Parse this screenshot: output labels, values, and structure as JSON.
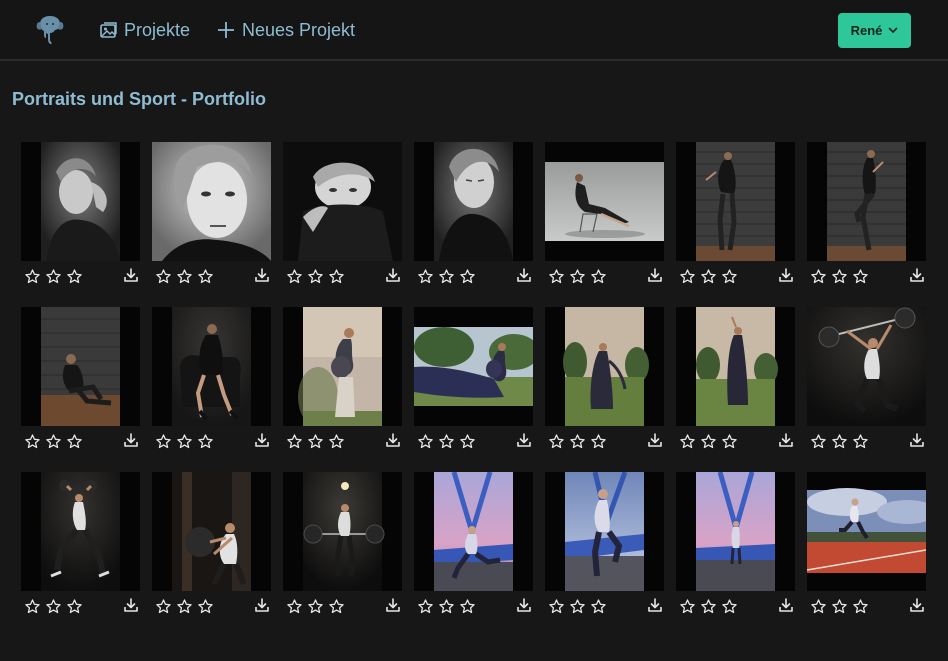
{
  "nav": {
    "projects_label": "Projekte",
    "new_project_label": "Neues Projekt",
    "user_label": "René",
    "logo_icon": "elephant-icon",
    "projects_icon": "image-icon",
    "new_project_icon": "plus-icon"
  },
  "page": {
    "title": "Portraits und Sport - Portfolio"
  },
  "colors": {
    "accent": "#2ec79a",
    "link": "#8fbcd1",
    "background": "#171717",
    "navbar": "#151515"
  },
  "photos": [
    {
      "subject": "bw-portrait-hand-on-head",
      "rating": 0
    },
    {
      "subject": "bw-portrait-closeup",
      "rating": 0
    },
    {
      "subject": "bw-portrait-turtleneck",
      "rating": 0
    },
    {
      "subject": "bw-portrait-eyes-closed",
      "rating": 0
    },
    {
      "subject": "studio-woman-on-chair",
      "rating": 0
    },
    {
      "subject": "woman-against-brick-wall",
      "rating": 0
    },
    {
      "subject": "woman-against-brick-wall-2",
      "rating": 0
    },
    {
      "subject": "woman-sitting-on-floor",
      "rating": 0
    },
    {
      "subject": "woman-in-leather-chair",
      "rating": 0
    },
    {
      "subject": "pregnant-woman-field",
      "rating": 0
    },
    {
      "subject": "pregnant-woman-flowing-fabric",
      "rating": 0
    },
    {
      "subject": "woman-in-dress-meadow",
      "rating": 0
    },
    {
      "subject": "woman-in-dress-meadow-2",
      "rating": 0
    },
    {
      "subject": "woman-barbell-overhead",
      "rating": 0
    },
    {
      "subject": "woman-kettlebell-lunge",
      "rating": 0
    },
    {
      "subject": "woman-medicine-ball-throw",
      "rating": 0
    },
    {
      "subject": "woman-barbell-gym",
      "rating": 0
    },
    {
      "subject": "runner-on-bridge",
      "rating": 0
    },
    {
      "subject": "runner-on-bridge-2",
      "rating": 0
    },
    {
      "subject": "runner-on-bridge-3",
      "rating": 0
    },
    {
      "subject": "runner-on-track",
      "rating": 0
    }
  ]
}
